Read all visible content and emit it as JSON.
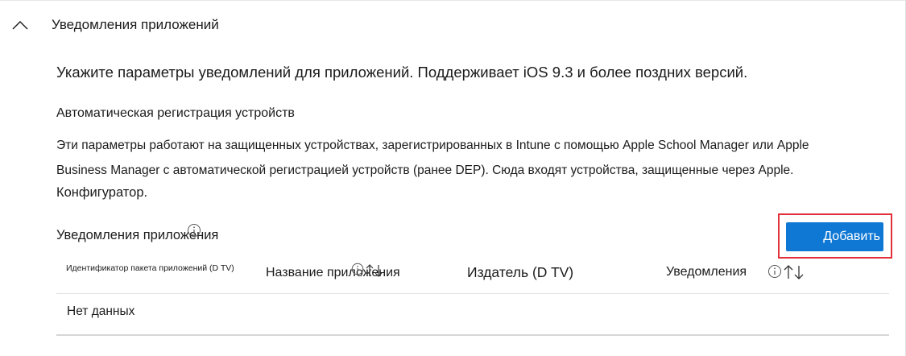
{
  "section": {
    "title": "Уведомления приложений",
    "expand_icon": "chevron-up-icon"
  },
  "intro": "Укажите параметры уведомлений для приложений. Поддерживает iOS 9.3 и более поздних версий.",
  "ade": {
    "heading": "Автоматическая регистрация устройств",
    "line1": "Эти параметры работают на защищенных устройствах, зарегистрированных в Intune с помощью Apple School Manager или Apple",
    "line2": "Business Manager с автоматической регистрацией устройств (ранее DEP). Сюда входят устройства, защищенные через Apple.",
    "line3": "Конфигуратор."
  },
  "table": {
    "title": "Уведомления приложения",
    "title_icon": "info-icon",
    "add_label": "Добавить",
    "columns": [
      {
        "label": "Идентификатор пакета приложений (D TV)"
      },
      {
        "label": "Название приложения",
        "icons": [
          "info-icon",
          "sort-icon"
        ]
      },
      {
        "label": "Издатель (D TV)"
      },
      {
        "label": "Уведомления",
        "icons": [
          "info-icon",
          "sort-icon"
        ]
      }
    ],
    "empty_text": "Нет данных"
  },
  "colors": {
    "accent": "#0f78d4",
    "highlight_border": "#e0303a",
    "divider": "#e1e1e1"
  }
}
